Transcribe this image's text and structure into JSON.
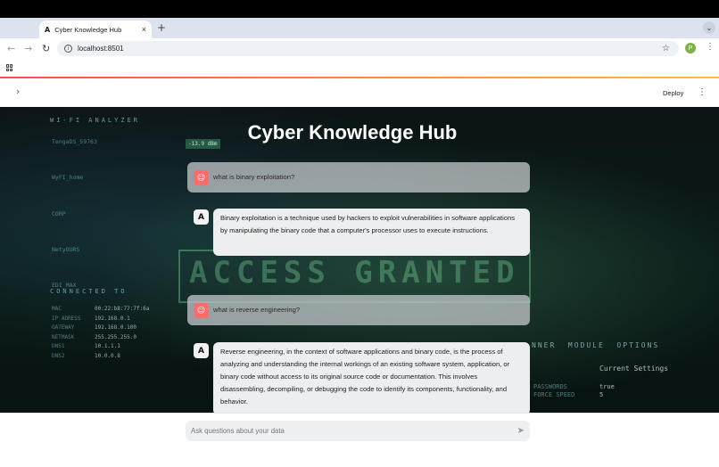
{
  "browser": {
    "tab_favicon": "A",
    "tab_title": "Cyber Knowledge Hub",
    "tab_close": "×",
    "new_tab": "+",
    "tab_menu": "⌄",
    "back": "←",
    "forward": "→",
    "reload": "↻",
    "info": "i",
    "url": "localhost:8501",
    "star": "☆",
    "profile_initial": "P",
    "menu": "⋮"
  },
  "header": {
    "sidebar_toggle": "›",
    "deploy_label": "Deploy",
    "menu": "⋮"
  },
  "app": {
    "title": "Cyber Knowledge Hub"
  },
  "chat": {
    "messages": [
      {
        "role": "user",
        "text": "what is binary exploitation?"
      },
      {
        "role": "assistant",
        "text": "Binary exploitation is a technique used by hackers to exploit vulnerabilities in software applications by manipulating the binary code that a computer's processor uses to execute instructions."
      },
      {
        "role": "user",
        "text": "what is reverse engineering?"
      },
      {
        "role": "assistant",
        "text": "Reverse engineering, in the context of software applications and binary code, is the process of analyzing and understanding the internal workings of an existing software system, application, or binary code without access to its original source code or documentation. This involves disassembling, decompiling, or debugging the code to identify its components, functionality, and behavior."
      }
    ],
    "input_placeholder": "Ask questions about your data",
    "send_icon": "➤"
  },
  "background": {
    "wifi_heading": "WI-FI ANALYZER",
    "networks": "TengaDS_59763\n\n\n\nWyFI_home\n\n\n\nCORP\n\n\n\nNetyOURS\n\n\n\nEDI_MAX",
    "signal": "-13.9 dBm",
    "connected_heading": "CONNECTED TO",
    "connected_labels": "MAC\nIP ADRESS\nGATEWAY\nNETMASK\nDNS1\nDNS2",
    "connected_values": "00:22:b8:77:7f:6a\n192.168.0.1\n192.168.0.100\n255.255.255.0\n10.1.1.1\n10.0.0.8",
    "access": "ACCESS GRANTED",
    "scanner": "NNER  MODULE  OPTIONS",
    "current_settings": "Current Settings",
    "settings_labels": "PASSWORDS\nFORCE SPEED",
    "settings_values": "true\n5"
  }
}
